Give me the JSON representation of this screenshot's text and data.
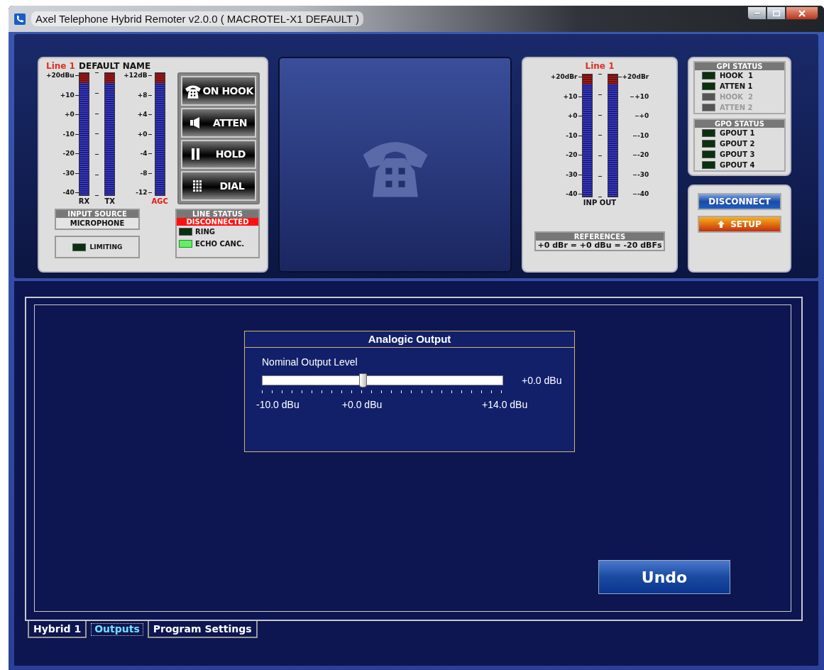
{
  "window": {
    "title": "Axel Telephone Hybrid Remoter v2.0.0 ( MACROTEL-X1 DEFAULT )"
  },
  "line_panel": {
    "line": "Line 1",
    "name": "DEFAULT NAME",
    "scale_main": [
      "+20dBu",
      "+10",
      "+0",
      "-10",
      "-20",
      "-30",
      "-40"
    ],
    "scale_agc": [
      "+12dB",
      "+8",
      "+4",
      "+0",
      "-4",
      "-8",
      "-12"
    ],
    "meters": [
      {
        "label": "RX",
        "color": "#111111"
      },
      {
        "label": "TX",
        "color": "#111111"
      },
      {
        "label": "AGC",
        "color": "#ee1111"
      }
    ],
    "buttons": [
      {
        "label": "ON HOOK",
        "kind": "phone"
      },
      {
        "label": "ATTEN",
        "kind": "speaker"
      },
      {
        "label": "HOLD",
        "kind": "pause"
      },
      {
        "label": "DIAL",
        "kind": "keypad"
      }
    ],
    "input_source": {
      "title": "INPUT SOURCE",
      "value": "MICROPHONE"
    },
    "limiting": {
      "label": "LIMITING",
      "on": false
    },
    "line_status": {
      "title": "LINE STATUS",
      "state": "DISCONNECTED",
      "leds": [
        {
          "label": "RING",
          "on": false
        },
        {
          "label": "ECHO CANC.",
          "on": true
        }
      ]
    }
  },
  "io_panel": {
    "line": "Line 1",
    "scale_in": [
      "+20dBr",
      "+10",
      "+0",
      "-10",
      "-20",
      "-30",
      "-40"
    ],
    "scale_out": [
      "+20dBr",
      "+10",
      "+0",
      "-10",
      "-20",
      "-30",
      "-40"
    ],
    "meters_label": "INP OUT",
    "references": {
      "title": "REFERENCES",
      "value": "+0 dBr = +0 dBu = -20 dBFs"
    }
  },
  "gpi": {
    "title": "GPI STATUS",
    "items": [
      {
        "label": "HOOK  1",
        "on": false,
        "disabled": false
      },
      {
        "label": "ATTEN 1",
        "on": false,
        "disabled": false
      },
      {
        "label": "HOOK  2",
        "on": false,
        "disabled": true
      },
      {
        "label": "ATTEN 2",
        "on": false,
        "disabled": true
      }
    ]
  },
  "gpo": {
    "title": "GPO STATUS",
    "items": [
      {
        "label": "GPOUT 1",
        "on": false,
        "disabled": false
      },
      {
        "label": "GPOUT 2",
        "on": false,
        "disabled": false
      },
      {
        "label": "GPOUT 3",
        "on": false,
        "disabled": false
      },
      {
        "label": "GPOUT 4",
        "on": false,
        "disabled": false
      }
    ]
  },
  "actions": [
    {
      "label": "DISCONNECT",
      "kind": "disconnect"
    },
    {
      "label": "SETUP",
      "kind": "setup"
    }
  ],
  "output_group": {
    "title": "Analogic Output",
    "label": "Nominal Output Level",
    "level": 0.4167,
    "reading": "+0.0 dBu",
    "scale": [
      "-10.0 dBu",
      "+0.0 dBu",
      "+14.0 dBu"
    ]
  },
  "undo": "Undo",
  "tabs": [
    {
      "label": "Hybrid 1",
      "selected": false
    },
    {
      "label": "Outputs",
      "selected": true
    },
    {
      "label": "Program Settings",
      "selected": false
    }
  ]
}
